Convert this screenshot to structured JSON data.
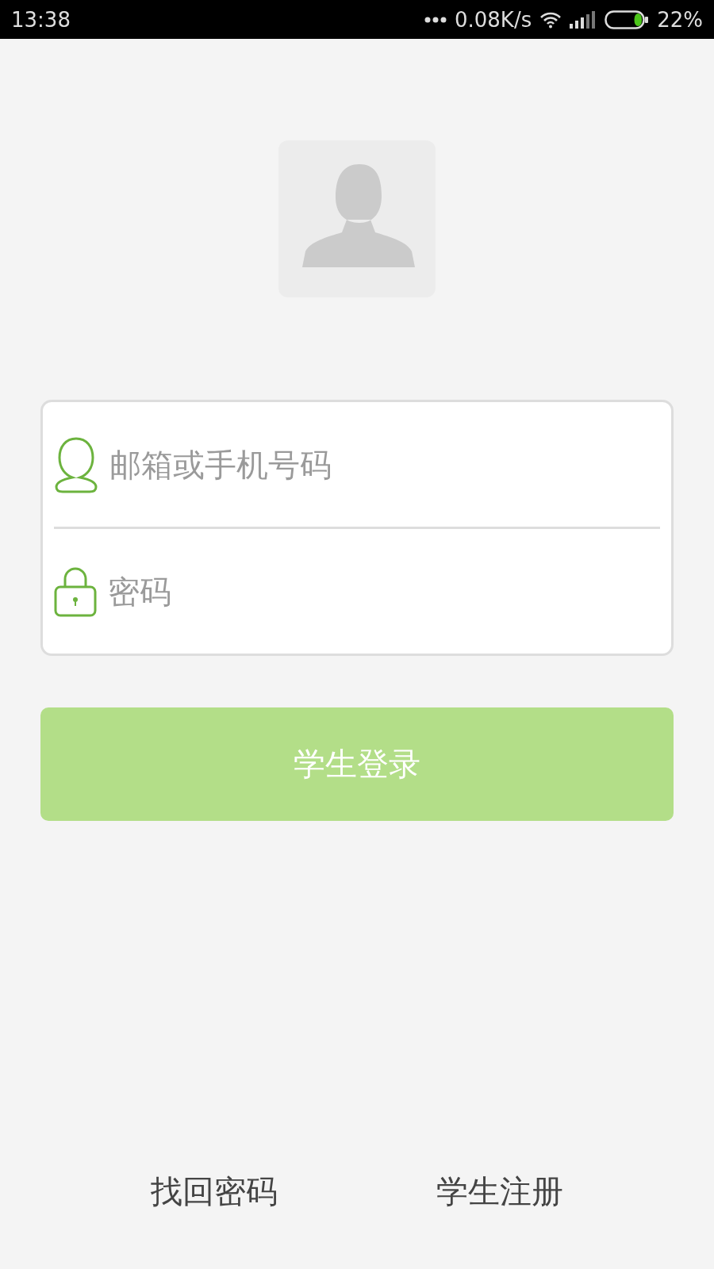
{
  "status_bar": {
    "time": "13:38",
    "network_speed": "0.08K/s",
    "battery": {
      "level": 0.22,
      "percent": "22%"
    }
  },
  "login_form": {
    "fields": [
      {
        "kind": "user",
        "placeholder": "邮箱或手机号码"
      },
      {
        "kind": "password",
        "placeholder": "密码"
      }
    ],
    "submit_button": "学生登录"
  },
  "links": [
    "找回密码",
    "学生注册"
  ]
}
